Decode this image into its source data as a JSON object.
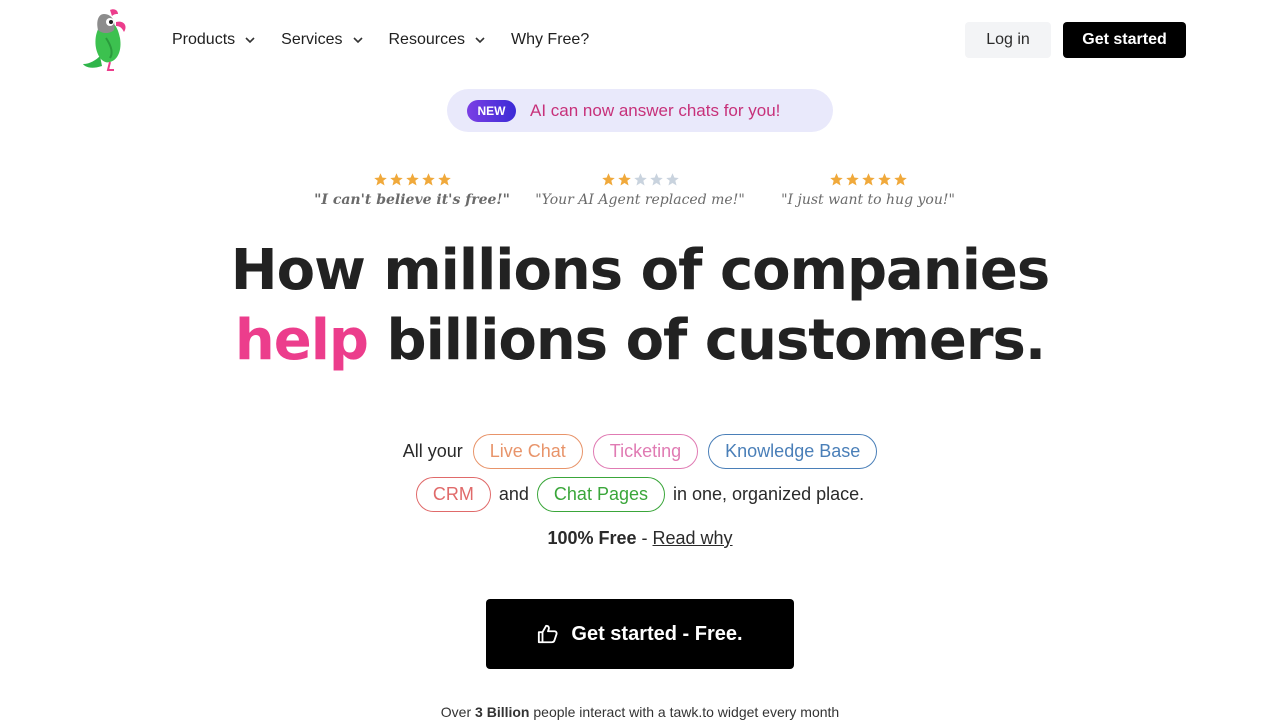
{
  "nav": {
    "logo_name": "parrot-logo",
    "menu": [
      {
        "label": "Products",
        "has_dropdown": true
      },
      {
        "label": "Services",
        "has_dropdown": true
      },
      {
        "label": "Resources",
        "has_dropdown": true
      },
      {
        "label": "Why Free?",
        "has_dropdown": false
      }
    ],
    "login_label": "Log in",
    "get_started_label": "Get started"
  },
  "announcement": {
    "badge": "NEW",
    "text": "AI can now answer chats for you!"
  },
  "reviews": [
    {
      "rating": 5,
      "quote": "\"I can't believe it's free!\""
    },
    {
      "rating": 2,
      "quote": "\"Your AI Agent replaced me!\""
    },
    {
      "rating": 5,
      "quote": "\"I just want to hug you!\""
    }
  ],
  "headline": {
    "line1": "How millions of companies",
    "line2_highlight": "help",
    "line2_rest": " billions of customers."
  },
  "features": {
    "prefix": "All your",
    "chips_row1": [
      {
        "label": "Live Chat",
        "color": "#e8946a"
      },
      {
        "label": "Ticketing",
        "color": "#e07bb3"
      },
      {
        "label": "Knowledge Base",
        "color": "#4a7fb8"
      }
    ],
    "crm": {
      "label": "CRM",
      "color": "#e06a6a"
    },
    "and": "and",
    "chat_pages": {
      "label": "Chat Pages",
      "color": "#3aa63a"
    },
    "suffix": "in one, organized place."
  },
  "free": {
    "bold": "100% Free",
    "sep": " - ",
    "link": "Read why"
  },
  "cta": {
    "label": "Get started - Free.",
    "icon": "thumbs-up-icon"
  },
  "footnote": {
    "pre": "Over ",
    "bold": "3 Billion",
    "post": " people interact with a tawk.to widget every month"
  },
  "colors": {
    "accent_pink": "#ec3d8c",
    "star_gold": "#f0a93b",
    "star_empty": "#c9d3de"
  }
}
